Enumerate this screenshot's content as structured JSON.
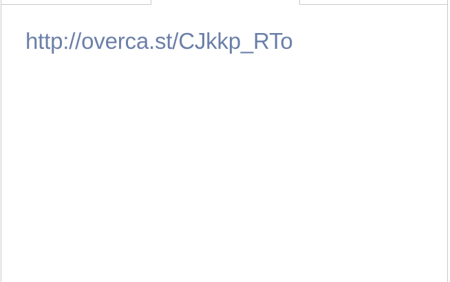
{
  "content": {
    "link_text": "http://overca.st/CJkkp_RTo",
    "link_color": "#6b7fa8"
  },
  "colors": {
    "border": "#c8c8c8",
    "background": "#ffffff"
  }
}
